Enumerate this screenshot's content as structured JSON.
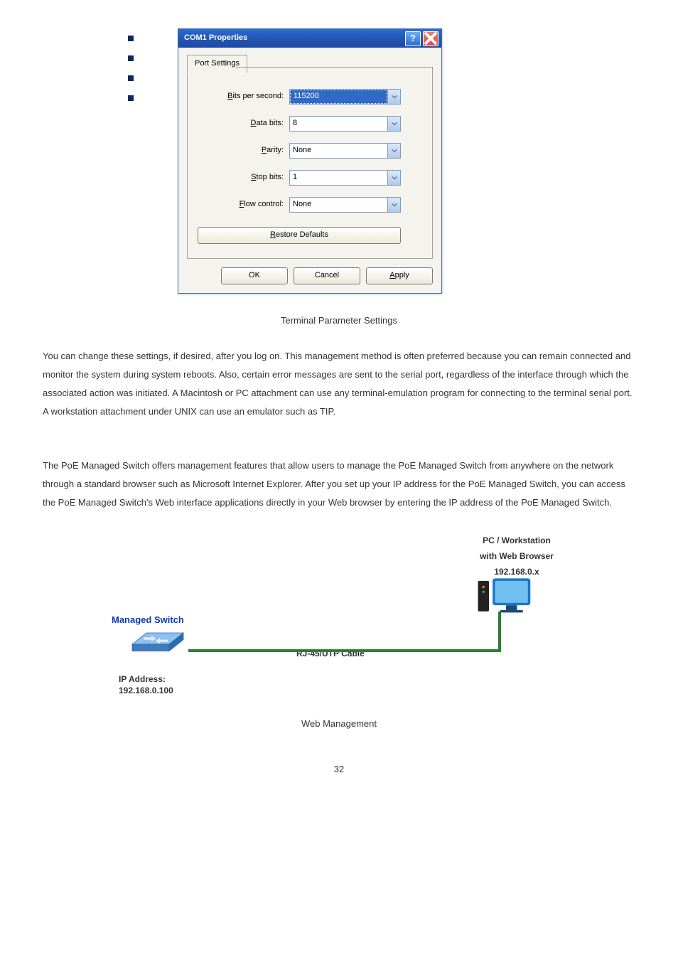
{
  "bullets": {
    "count": 4
  },
  "dialog": {
    "title": "COM1 Properties",
    "tab_label": "Port Settings",
    "fields": {
      "bits_label_pre": "B",
      "bits_label_post": "its per second:",
      "bits_value": "115200",
      "data_label_pre": "D",
      "data_label_post": "ata bits:",
      "data_value": "8",
      "parity_label_pre": "P",
      "parity_label_post": "arity:",
      "parity_value": "None",
      "stop_label_pre": "S",
      "stop_label_post": "top bits:",
      "stop_value": "1",
      "flow_label_pre": "F",
      "flow_label_post": "low control:",
      "flow_value": "None"
    },
    "restore_pre": "R",
    "restore_post": "estore Defaults",
    "ok": "OK",
    "cancel": "Cancel",
    "apply_pre": "A",
    "apply_post": "pply"
  },
  "figure1_caption": "Terminal Parameter Settings",
  "para1": "You can change these settings, if desired, after you log on. This management method is often preferred because you can remain connected and monitor the system during system reboots. Also, certain error messages are sent to the serial port, regardless of the interface through which the associated action was initiated. A Macintosh or PC attachment can use any terminal-emulation program for connecting to the terminal serial port. A workstation attachment under UNIX can use an emulator such as TIP.",
  "para2": "The PoE Managed Switch offers management features that allow users to manage the PoE Managed Switch from anywhere on the network through a standard browser such as Microsoft Internet Explorer. After you set up your IP address for the PoE Managed Switch, you can access the PoE Managed Switch's Web interface applications directly in your Web browser by entering the IP address of the PoE Managed Switch.",
  "diagram": {
    "pc_label_l1": "PC / Workstation",
    "pc_label_l2": "with Web Browser",
    "pc_label_l3": "192.168.0.x",
    "ms_label": "Managed Switch",
    "cable_label": "RJ-45/UTP Cable",
    "ip_l1": "IP Address:",
    "ip_l2": "192.168.0.100"
  },
  "figure2_caption": "Web Management",
  "page_number": "32"
}
